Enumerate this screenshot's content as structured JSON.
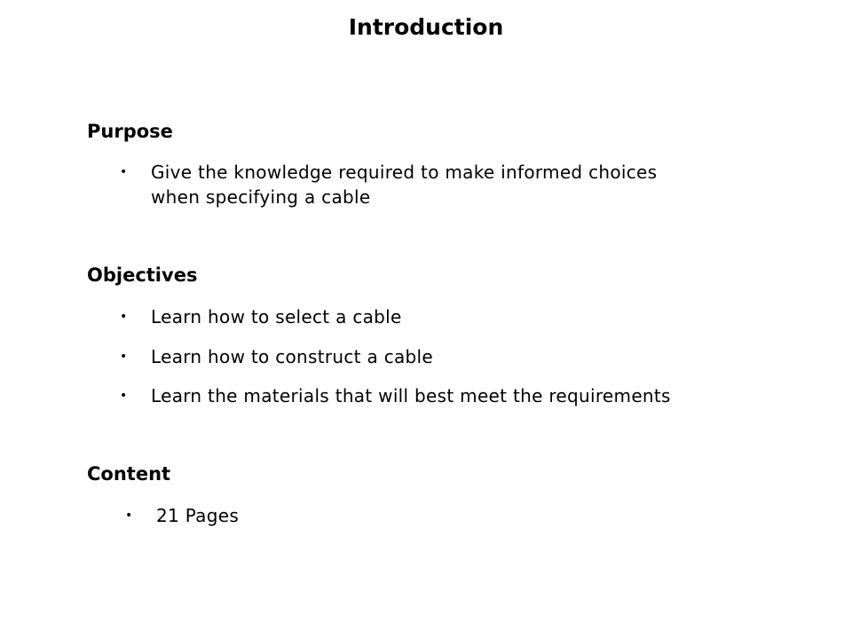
{
  "title": "Introduction",
  "sections": [
    {
      "heading": "Purpose",
      "items": [
        "Give the knowledge required to make informed choices",
        "when specifying a cable"
      ]
    },
    {
      "heading": "Objectives",
      "items": [
        "Learn how to select a cable",
        "Learn how to construct a cable",
        "Learn the materials that will best meet the requirements"
      ]
    },
    {
      "heading": "Content",
      "items": [
        "21 Pages"
      ]
    }
  ],
  "bullet_glyph": "•"
}
